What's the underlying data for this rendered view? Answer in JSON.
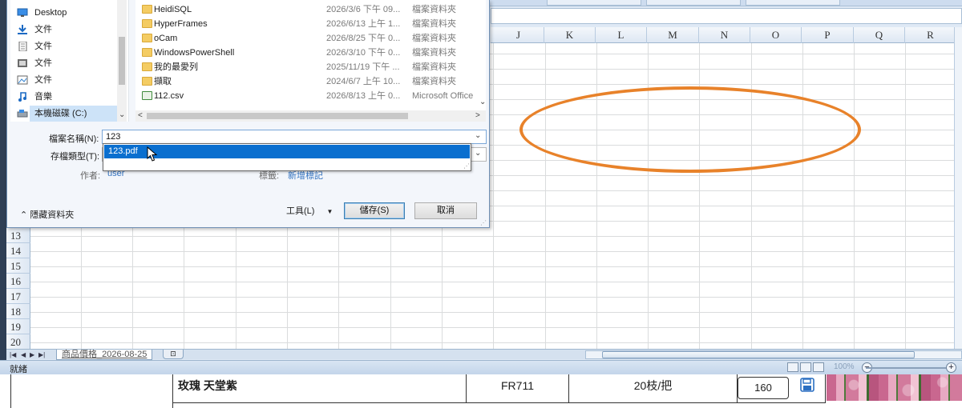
{
  "dialog": {
    "nav_items": [
      {
        "label": "Desktop",
        "icon": "desktop-icon"
      },
      {
        "label": "文件",
        "icon": "download-icon"
      },
      {
        "label": "文件",
        "icon": "document-icon"
      },
      {
        "label": "文件",
        "icon": "video-icon"
      },
      {
        "label": "文件",
        "icon": "picture-icon"
      },
      {
        "label": "音樂",
        "icon": "music-icon"
      },
      {
        "label": "本機磁碟 (C:)",
        "icon": "drive-icon"
      }
    ],
    "files": [
      {
        "name": "HeidiSQL",
        "date": "2026/3/6 下午 09...",
        "type": "檔案資料夾",
        "icon": "folder-icon"
      },
      {
        "name": "HyperFrames",
        "date": "2026/6/13 上午 1...",
        "type": "檔案資料夾",
        "icon": "folder-icon"
      },
      {
        "name": "oCam",
        "date": "2026/8/25 下午 0...",
        "type": "檔案資料夾",
        "icon": "folder-icon"
      },
      {
        "name": "WindowsPowerShell",
        "date": "2026/3/10 下午 0...",
        "type": "檔案資料夾",
        "icon": "folder-icon"
      },
      {
        "name": "我的最愛列",
        "date": "2025/11/19 下午 ...",
        "type": "檔案資料夾",
        "icon": "folder-icon"
      },
      {
        "name": "擷取",
        "date": "2024/6/7 上午 10...",
        "type": "檔案資料夾",
        "icon": "folder-icon"
      },
      {
        "name": "112.csv",
        "date": "2026/8/13 上午 0...",
        "type": "Microsoft Office",
        "icon": "csv-file-icon"
      }
    ],
    "filename_label": "檔案名稱(N):",
    "filename_value": "123",
    "filetype_label": "存檔類型(T):",
    "autocomplete_suggestion": "123.pdf",
    "author_label": "作者:",
    "author_value": "user",
    "tags_label": "標籤:",
    "tags_value": "新增標記",
    "hide_folders_label": "隱藏資料夾",
    "tools_label": "工具(L)",
    "save_label": "儲存(S)",
    "cancel_label": "取消"
  },
  "excel": {
    "columns": [
      "J",
      "K",
      "L",
      "M",
      "N",
      "O",
      "P",
      "Q",
      "R"
    ],
    "rows": [
      "13",
      "14",
      "15",
      "16",
      "17",
      "18",
      "19",
      "20"
    ],
    "sheet_tab": "商品價格_2026-08-25",
    "status_text": "就緒",
    "zoom_level": "100%",
    "annotation_color": "#e8822a"
  },
  "product": {
    "name": "玫瑰 天堂紫",
    "code": "FR711",
    "quantity": "20枝/把",
    "price": "160"
  }
}
